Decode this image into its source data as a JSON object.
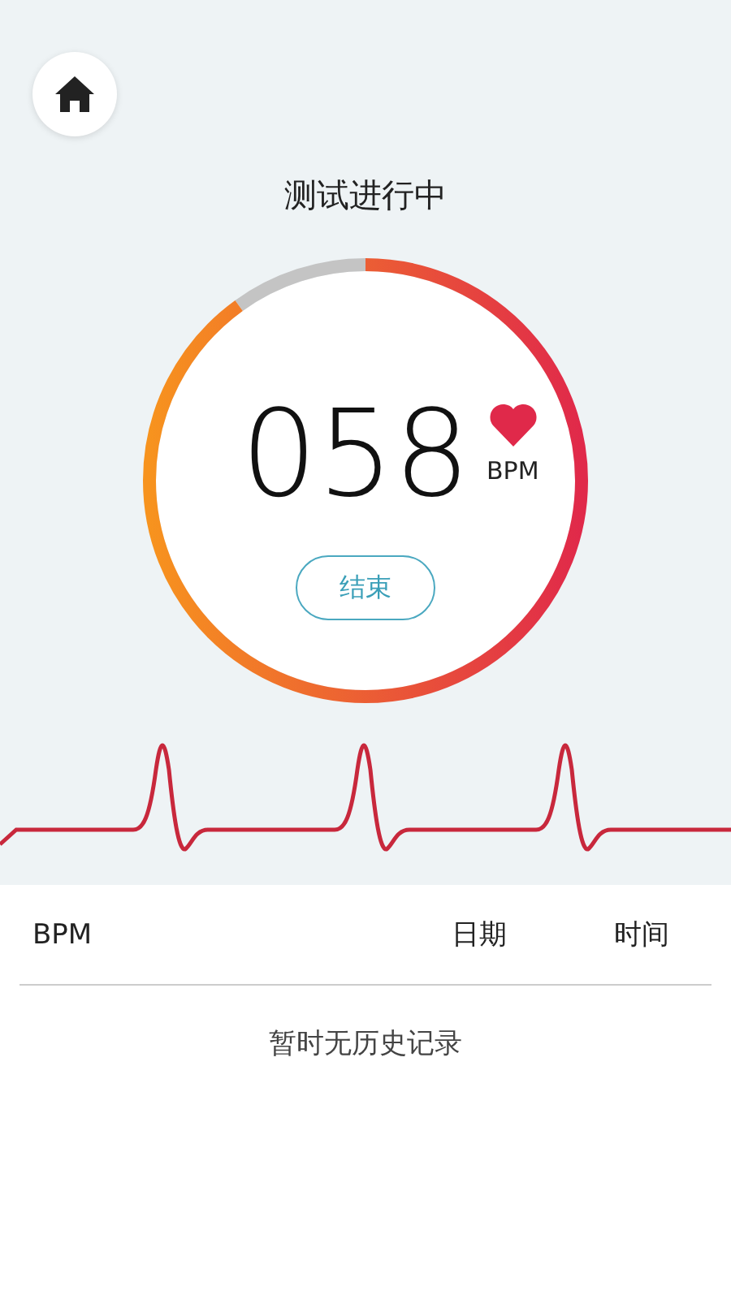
{
  "title": "测试进行中",
  "meter": {
    "level": 0.9,
    "reading": "058",
    "unit": "BPM",
    "button": "结束"
  },
  "history": {
    "columns": [
      "BPM",
      "日期",
      "时间"
    ],
    "empty_message": "暂时无历史记录"
  }
}
